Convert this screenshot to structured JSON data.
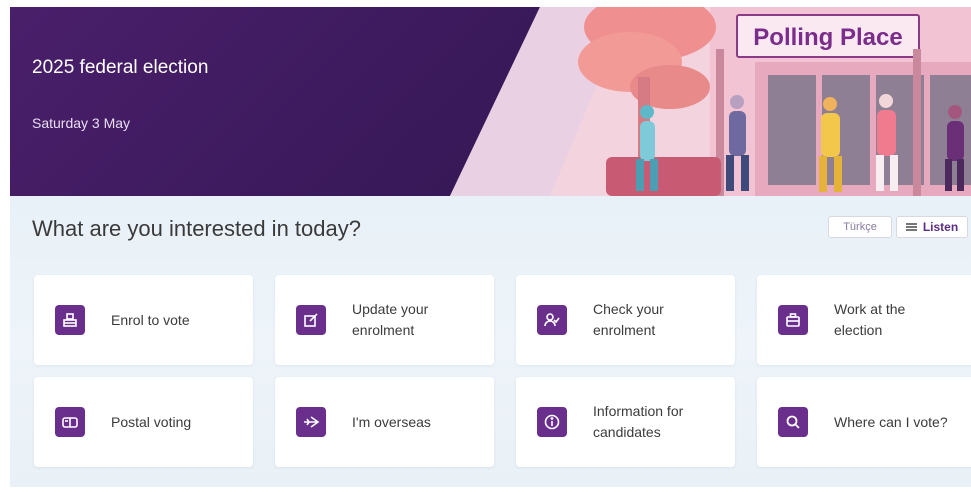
{
  "hero": {
    "title": "2025 federal election",
    "date": "Saturday 3 May",
    "sign_text": "Polling Place"
  },
  "main": {
    "heading": "What are you interested in today?",
    "language_button": "Türkçe",
    "listen_button": "Listen"
  },
  "tiles": [
    {
      "label": "Enrol to vote",
      "icon": "ballot-box-icon"
    },
    {
      "label": "Update your\nenrolment",
      "icon": "edit-form-icon"
    },
    {
      "label": "Check your\nenrolment",
      "icon": "person-check-icon"
    },
    {
      "label": "Work at the\nelection",
      "icon": "briefcase-icon"
    },
    {
      "label": "Postal voting",
      "icon": "mailbox-icon"
    },
    {
      "label": "I'm overseas",
      "icon": "plane-icon"
    },
    {
      "label": "Information for\ncandidates",
      "icon": "info-icon"
    },
    {
      "label": "Where can I vote?",
      "icon": "search-icon"
    }
  ],
  "colors": {
    "hero_purple": "#3c1a5d",
    "icon_purple": "#6a2f8c",
    "content_bg": "#e8f1f8"
  }
}
